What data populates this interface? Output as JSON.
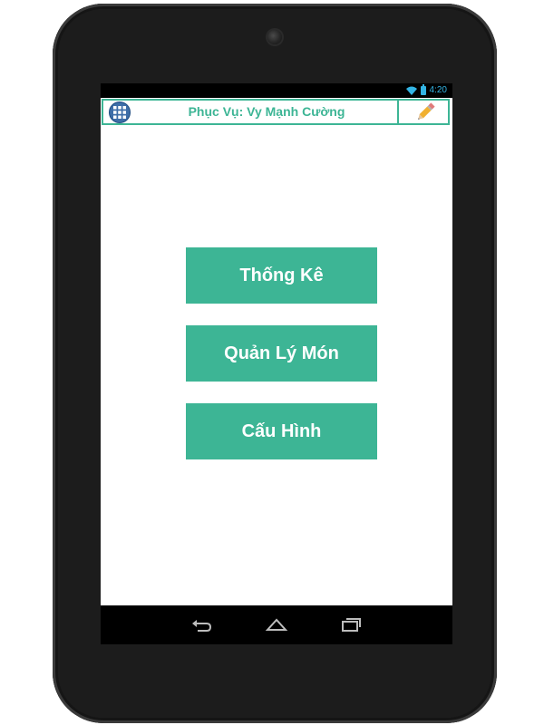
{
  "status_bar": {
    "time": "4:20",
    "wifi_icon": "wifi-icon",
    "battery_icon": "battery-icon"
  },
  "app_bar": {
    "menu_icon": "grid-icon",
    "title": "Phục Vụ: Vy Mạnh Cường",
    "edit_icon": "pencil-icon"
  },
  "menu": {
    "items": [
      {
        "label": "Thống Kê"
      },
      {
        "label": "Quản Lý Món"
      },
      {
        "label": "Cấu Hình"
      }
    ]
  },
  "nav_bar": {
    "back_icon": "back-icon",
    "home_icon": "home-icon",
    "recent_icon": "recent-apps-icon"
  },
  "colors": {
    "accent": "#3db595",
    "menu_icon_bg": "#3e6ea8",
    "status_accent": "#33b5e5"
  }
}
